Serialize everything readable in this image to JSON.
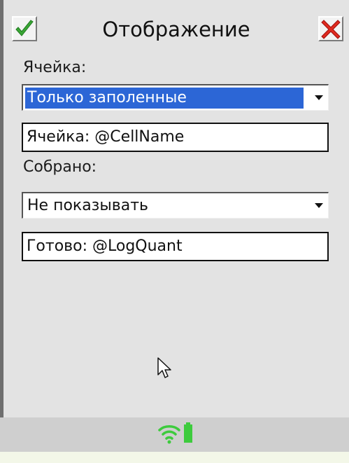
{
  "window": {
    "title": "Отображение"
  },
  "toolbar": {
    "ok_icon": "checkmark-icon",
    "cancel_icon": "close-icon"
  },
  "cell": {
    "label": "Ячейка:",
    "mode_selected": "Только заполенные",
    "format": "Ячейка: @CellName"
  },
  "collected": {
    "label": "Собрано:",
    "mode_selected": "Не показывать",
    "format": "Готово: @LogQuant"
  },
  "status_bar": {
    "icons": [
      "wifi-icon",
      "battery-icon"
    ]
  },
  "colors": {
    "accent": "#2c66d6",
    "ok_green": "#3aa635",
    "cancel_red": "#e02a1f",
    "status_green": "#3dcb3d"
  }
}
